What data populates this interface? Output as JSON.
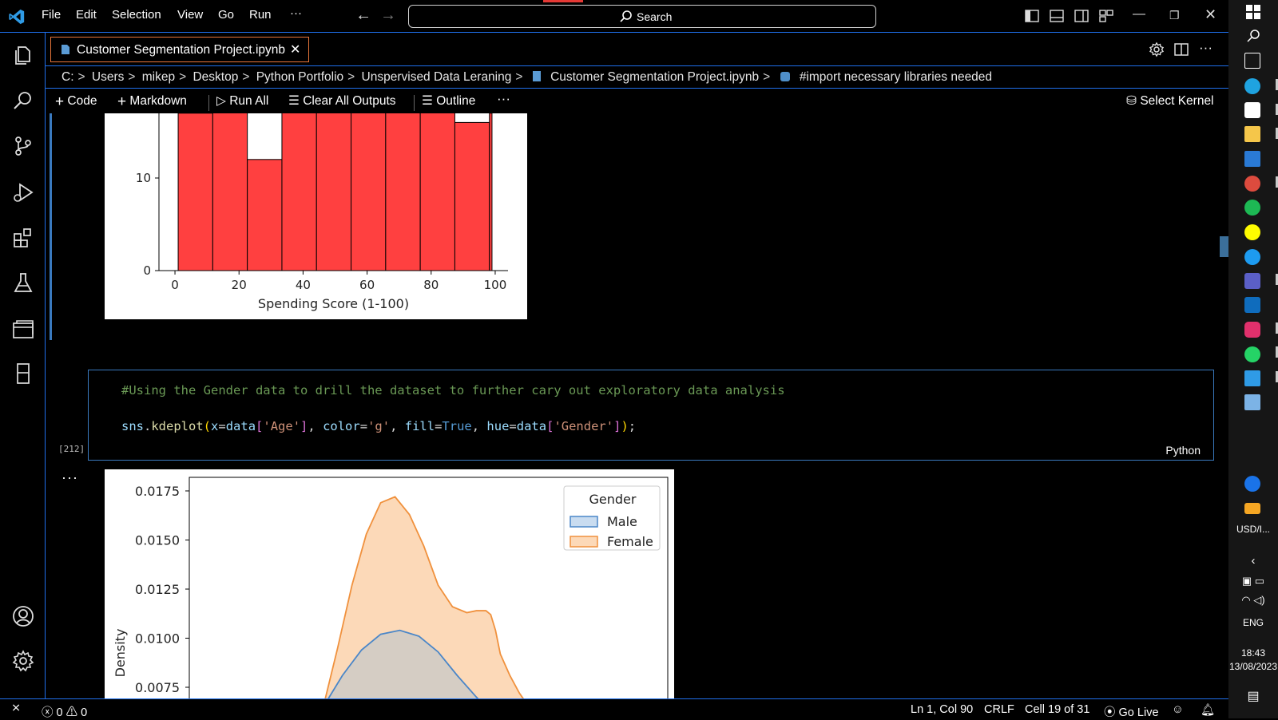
{
  "titlebar": {
    "menus": [
      "File",
      "Edit",
      "Selection",
      "View",
      "Go",
      "Run",
      "···"
    ],
    "search_label": "Search"
  },
  "tab": {
    "label": "Customer Segmentation Project.ipynb"
  },
  "breadcrumb": [
    "C:",
    "Users",
    "mikep",
    "Desktop",
    "Python Portfolio",
    "Unspervised Data Leraning",
    "Customer Segmentation Project.ipynb",
    "#import necessary libraries needed"
  ],
  "toolbar": {
    "code_label": "Code",
    "markdown_label": "Markdown",
    "run_all_label": "Run All",
    "clear_label": "Clear All Outputs",
    "outline_label": "Outline",
    "more_label": "···",
    "kernel_label": "Select Kernel"
  },
  "cell": {
    "comment": "#Using the Gender data to drill the dataset to further cary out exploratory data analysis",
    "code_tokens": [
      {
        "t": "sns",
        "c": "#9cdcfe"
      },
      {
        "t": ".",
        "c": "#d4d4d4"
      },
      {
        "t": "kdeplot",
        "c": "#dcdcaa"
      },
      {
        "t": "(",
        "c": "#ffd700"
      },
      {
        "t": "x",
        "c": "#9cdcfe"
      },
      {
        "t": "=",
        "c": "#d4d4d4"
      },
      {
        "t": "data",
        "c": "#9cdcfe"
      },
      {
        "t": "[",
        "c": "#da70d6"
      },
      {
        "t": "'Age'",
        "c": "#ce9178"
      },
      {
        "t": "]",
        "c": "#da70d6"
      },
      {
        "t": ", ",
        "c": "#d4d4d4"
      },
      {
        "t": "color",
        "c": "#9cdcfe"
      },
      {
        "t": "=",
        "c": "#d4d4d4"
      },
      {
        "t": "'g'",
        "c": "#ce9178"
      },
      {
        "t": ", ",
        "c": "#d4d4d4"
      },
      {
        "t": "fill",
        "c": "#9cdcfe"
      },
      {
        "t": "=",
        "c": "#d4d4d4"
      },
      {
        "t": "True",
        "c": "#569cd6"
      },
      {
        "t": ", ",
        "c": "#d4d4d4"
      },
      {
        "t": "hue",
        "c": "#9cdcfe"
      },
      {
        "t": "=",
        "c": "#d4d4d4"
      },
      {
        "t": "data",
        "c": "#9cdcfe"
      },
      {
        "t": "[",
        "c": "#da70d6"
      },
      {
        "t": "'Gender'",
        "c": "#ce9178"
      },
      {
        "t": "]",
        "c": "#da70d6"
      },
      {
        "t": ")",
        "c": "#ffd700"
      },
      {
        "t": ";",
        "c": "#d4d4d4"
      }
    ],
    "exec_count": "[212]",
    "language": "Python",
    "output_more": "···"
  },
  "chart_data": [
    {
      "type": "bar",
      "xlabel": "Spending Score (1-100)",
      "ylabel": "",
      "bin_edges": [
        1,
        11.8,
        22.6,
        33.4,
        44.2,
        55,
        65.8,
        76.6,
        87.4,
        98.2,
        99
      ],
      "values": [
        17,
        24,
        12,
        22,
        22,
        22,
        22,
        20,
        16,
        17
      ],
      "xticks": [
        0,
        20,
        40,
        60,
        80,
        100
      ],
      "yticks": [
        0,
        10
      ],
      "xlim": [
        -5,
        104
      ],
      "ylim": [
        0,
        20
      ],
      "bar_color": "#ff4040"
    },
    {
      "type": "area",
      "ylabel": "Density",
      "legend": {
        "title": "Gender",
        "entries": [
          "Male",
          "Female"
        ],
        "position": "top-right"
      },
      "yticks": [
        "0.0075",
        "0.0100",
        "0.0125",
        "0.0150",
        "0.0175"
      ],
      "ylim": [
        0.0065,
        0.0185
      ],
      "xlim": [
        0,
        100
      ],
      "series": [
        {
          "name": "Male",
          "color": "#4a86c8",
          "fill": "#c8c8c8",
          "x": [
            28,
            32,
            36,
            40,
            44,
            48,
            52,
            56,
            60,
            62
          ],
          "y": [
            0.0065,
            0.0081,
            0.0094,
            0.0102,
            0.0104,
            0.0101,
            0.0093,
            0.0081,
            0.007,
            0.0065
          ]
        },
        {
          "name": "Female",
          "color": "#f0913d",
          "fill": "#fcd9b8",
          "x": [
            28,
            31,
            34,
            37,
            40,
            43,
            46,
            49,
            52,
            55,
            58,
            60,
            62,
            63,
            64,
            65,
            67,
            69,
            71
          ],
          "y": [
            0.0065,
            0.0095,
            0.0127,
            0.0153,
            0.0169,
            0.0172,
            0.0163,
            0.0147,
            0.0127,
            0.0116,
            0.0113,
            0.0114,
            0.0114,
            0.0112,
            0.0104,
            0.0092,
            0.0081,
            0.0072,
            0.0065
          ]
        }
      ]
    }
  ],
  "status": {
    "errors": "0",
    "warnings": "0",
    "position": "Ln 1, Col 90",
    "eol": "CRLF",
    "cell_info": "Cell 19 of 31",
    "golive": "Go Live"
  },
  "taskbar": {
    "currency": "USD/I...",
    "lang": "ENG",
    "time": "18:43",
    "date": "13/08/2023"
  }
}
